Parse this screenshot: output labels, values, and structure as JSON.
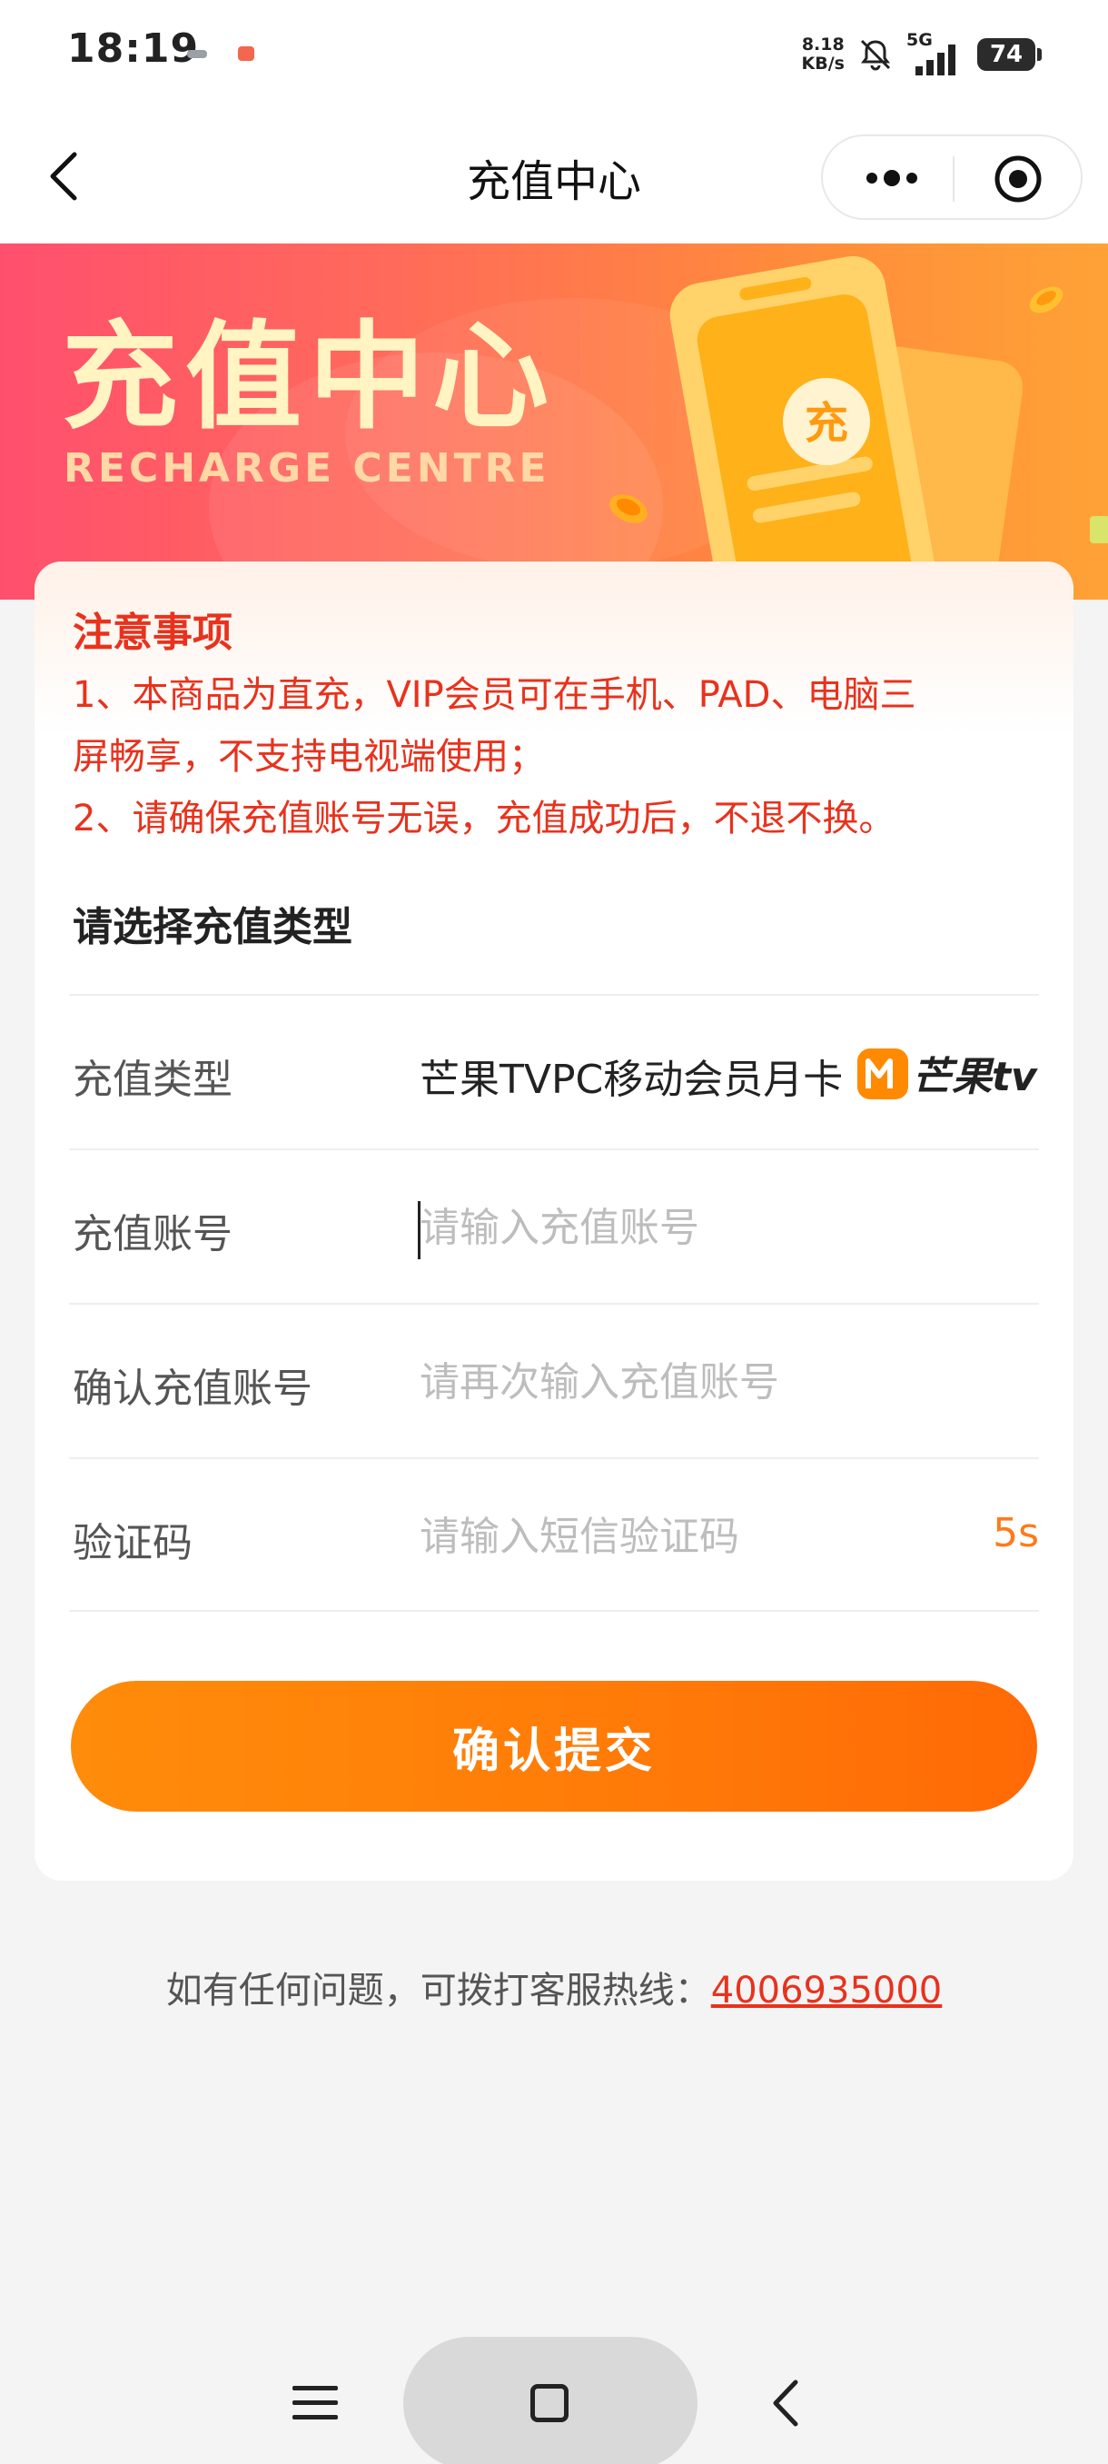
{
  "status_bar": {
    "time": "18:19",
    "net_speed_value": "8.18",
    "net_speed_unit": "KB/s",
    "network": "5G",
    "battery": "74"
  },
  "nav": {
    "title": "充值中心"
  },
  "banner": {
    "title": "充值中心",
    "subtitle": "RECHARGE CENTRE",
    "badge": "充"
  },
  "notice": {
    "title": "注意事项",
    "line1": "1、本商品为直充，VIP会员可在手机、PAD、电脑三",
    "line2": "屏畅享，不支持电视端使用；",
    "line3": "2、请确保充值账号无误，充值成功后，不退不换。"
  },
  "form": {
    "section_title": "请选择充值类型",
    "type": {
      "label": "充值类型",
      "value": "芒果TVPC移动会员月卡",
      "logo_text": "芒果tv"
    },
    "account": {
      "label": "充值账号",
      "placeholder": "请输入充值账号"
    },
    "confirm_account": {
      "label": "确认充值账号",
      "placeholder": "请再次输入充值账号"
    },
    "code": {
      "label": "验证码",
      "placeholder": "请输入短信验证码",
      "countdown": "5s"
    },
    "submit_label": "确认提交"
  },
  "footer": {
    "hotline_label": "如有任何问题，可拨打客服热线：",
    "hotline_number": "4006935000"
  },
  "colors": {
    "accent_orange": "#ff7a08",
    "notice_red": "#e8321d"
  }
}
